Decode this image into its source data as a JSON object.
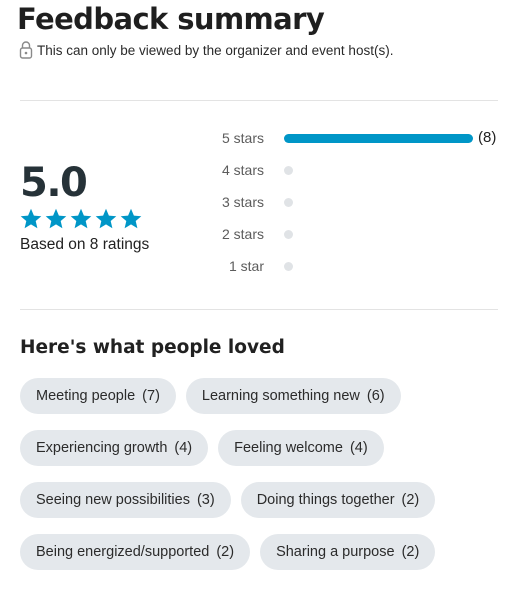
{
  "header": {
    "title": "Feedback summary",
    "privacy_note": "This can only be viewed by the organizer and event host(s)."
  },
  "rating": {
    "score": "5.0",
    "stars_filled": 5,
    "stars_total": 5,
    "based_on": "Based on 8 ratings",
    "star_color": "#0096c7"
  },
  "distribution": [
    {
      "label": "5 stars",
      "count_label": "(8)",
      "fraction": 1.0
    },
    {
      "label": "4 stars",
      "count_label": "",
      "fraction": 0
    },
    {
      "label": "3 stars",
      "count_label": "",
      "fraction": 0
    },
    {
      "label": "2 stars",
      "count_label": "",
      "fraction": 0
    },
    {
      "label": "1 star",
      "count_label": "",
      "fraction": 0
    }
  ],
  "loved": {
    "title": "Here's what people loved",
    "chips": [
      {
        "label": "Meeting people",
        "count": "(7)"
      },
      {
        "label": "Learning something new",
        "count": "(6)"
      },
      {
        "label": "Experiencing growth",
        "count": "(4)"
      },
      {
        "label": "Feeling welcome",
        "count": "(4)"
      },
      {
        "label": "Seeing new possibilities",
        "count": "(3)"
      },
      {
        "label": "Doing things together",
        "count": "(2)"
      },
      {
        "label": "Being energized/supported",
        "count": "(2)"
      },
      {
        "label": "Sharing a purpose",
        "count": "(2)"
      }
    ]
  },
  "icons": {
    "privacy": "lock-icon",
    "rating": "star-icon"
  }
}
